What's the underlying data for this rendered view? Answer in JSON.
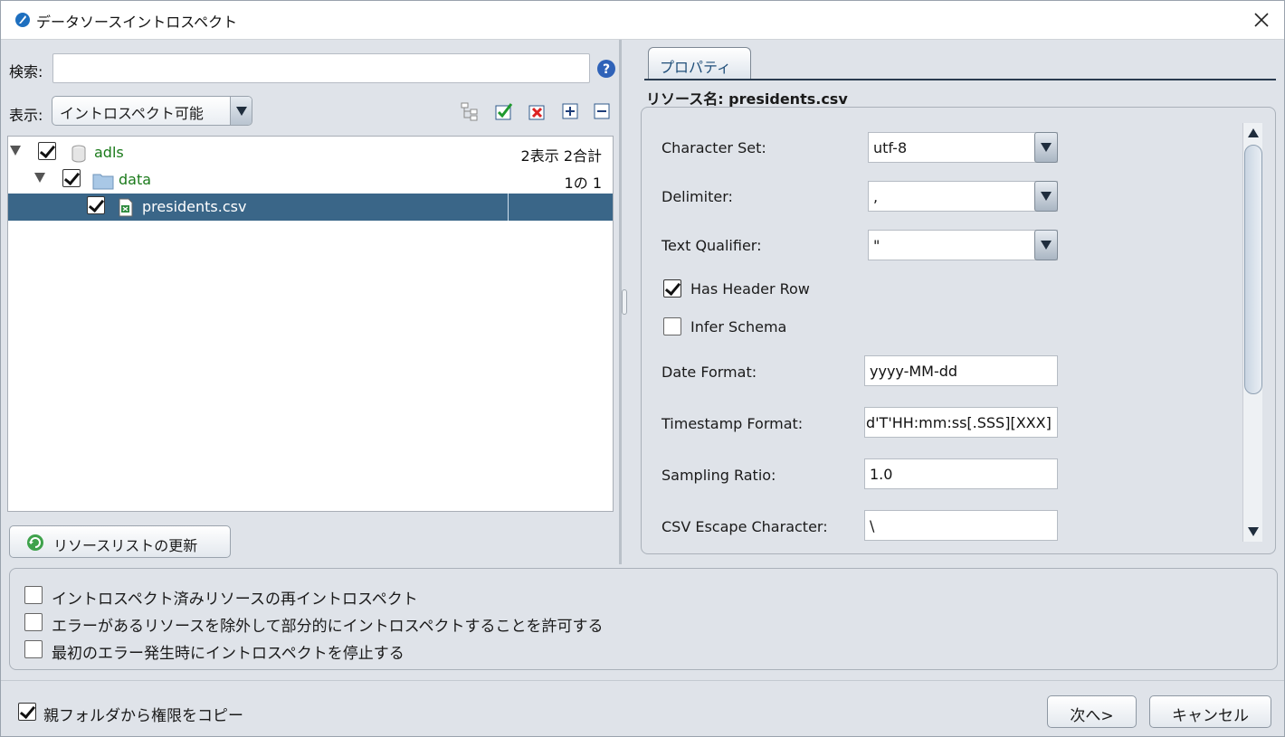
{
  "window": {
    "title": "データソースイントロスペクト",
    "close_glyph": "✕"
  },
  "search": {
    "label": "検索:",
    "value": "",
    "placeholder": ""
  },
  "view": {
    "label": "表示:",
    "selected": "イントロスペクト可能"
  },
  "toolbar_icons": [
    "tree-structure-icon",
    "check-all-icon",
    "uncheck-all-icon",
    "expand-all-icon",
    "collapse-all-icon"
  ],
  "tree": {
    "rows": [
      {
        "label": "adls",
        "count": "2表示 2合計",
        "checked": true,
        "icon": "database-icon"
      },
      {
        "label": "data",
        "count": "1の 1",
        "checked": true,
        "icon": "folder-icon"
      },
      {
        "label": "presidents.csv",
        "count": "",
        "checked": true,
        "icon": "csv-file-icon",
        "selected": true
      }
    ]
  },
  "refresh_button": {
    "label": "リソースリストの更新"
  },
  "properties": {
    "tab_label": "プロパティ",
    "resource_name": "リソース名: presidents.csv",
    "character_set": {
      "label": "Character Set:",
      "value": "utf-8"
    },
    "delimiter": {
      "label": "Delimiter:",
      "value": ","
    },
    "text_qualifier": {
      "label": "Text Qualifier:",
      "value": "\""
    },
    "has_header_row": {
      "label": "Has Header Row",
      "checked": true
    },
    "infer_schema": {
      "label": "Infer Schema",
      "checked": false
    },
    "date_format": {
      "label": "Date Format:",
      "value": "yyyy-MM-dd"
    },
    "timestamp_format": {
      "label": "Timestamp Format:",
      "value": "d'T'HH:mm:ss[.SSS][XXX]"
    },
    "sampling_ratio": {
      "label": "Sampling Ratio:",
      "value": "1.0"
    },
    "csv_escape_character": {
      "label": "CSV Escape Character:",
      "value": "\\"
    }
  },
  "options": [
    {
      "label": "イントロスペクト済みリソースの再イントロスペクト",
      "checked": false
    },
    {
      "label": "エラーがあるリソースを除外して部分的にイントロスペクトすることを許可する",
      "checked": false
    },
    {
      "label": "最初のエラー発生時にイントロスペクトを停止する",
      "checked": false
    }
  ],
  "copy_permissions": {
    "label": "親フォルダから権限をコピー",
    "checked": true
  },
  "buttons": {
    "next": "次へ>",
    "cancel": "キャンセル"
  },
  "colors": {
    "selection": "#3a6688",
    "tree_green": "#1b7a1b",
    "background": "#dfe3e9"
  }
}
